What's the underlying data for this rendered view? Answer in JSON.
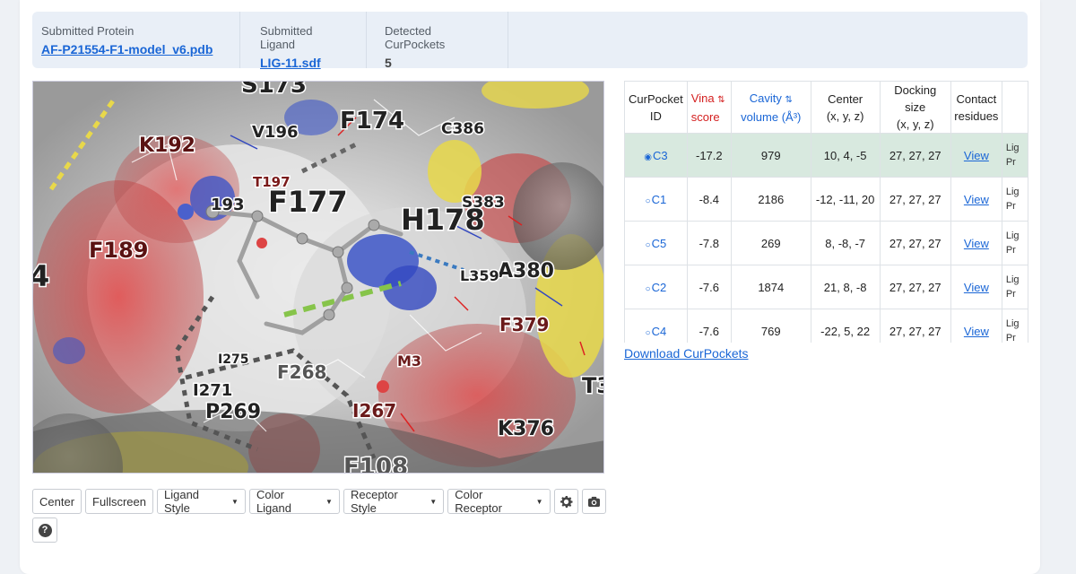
{
  "info": {
    "protein_label": "Submitted Protein",
    "protein_value": "AF-P21554-F1-model_v6.pdb",
    "ligand_label": "Submitted Ligand",
    "ligand_value": "LIG-11.sdf",
    "pockets_label": "Detected CurPockets",
    "pockets_value": "5"
  },
  "viewer": {
    "residue_labels": [
      "S173",
      "F174",
      "K192",
      "V196",
      "C386",
      "T197",
      "F177",
      "H178",
      "S383",
      "F189",
      "A380",
      "L359",
      "F379",
      "I275",
      "F268",
      "M3",
      "I271",
      "P269",
      "I267",
      "K376",
      "T3",
      "F108",
      "193",
      "4"
    ]
  },
  "toolbar": {
    "center": "Center",
    "fullscreen": "Fullscreen",
    "ligand_style": "Ligand Style",
    "color_ligand": "Color Ligand",
    "receptor_style": "Receptor Style",
    "color_receptor": "Color Receptor",
    "settings_icon": "gear-icon",
    "camera_icon": "camera-icon",
    "help_icon": "question-icon",
    "help_glyph": "?"
  },
  "table": {
    "headers": {
      "pocket_id_1": "CurPocket",
      "pocket_id_2": "ID",
      "vina_1": "Vina",
      "vina_2": "score",
      "cavity_1": "Cavity",
      "cavity_2": "volume (Å³)",
      "center_1": "Center",
      "center_2": "(x, y, z)",
      "docking_1": "Docking size",
      "docking_2": "(x, y, z)",
      "contact_1": "Contact",
      "contact_2": "residues",
      "sort_icon": "sort-icon"
    },
    "rows": [
      {
        "id": "C3",
        "vina": "-17.2",
        "cavity": "979",
        "center": "10, 4, -5",
        "docking": "27, 27, 27",
        "contact": "View",
        "extra1": "Lig",
        "extra2": "Pr",
        "selected": true
      },
      {
        "id": "C1",
        "vina": "-8.4",
        "cavity": "2186",
        "center": "-12, -11, 20",
        "docking": "27, 27, 27",
        "contact": "View",
        "extra1": "Lig",
        "extra2": "Pr"
      },
      {
        "id": "C5",
        "vina": "-7.8",
        "cavity": "269",
        "center": "8, -8, -7",
        "docking": "27, 27, 27",
        "contact": "View",
        "extra1": "Lig",
        "extra2": "Pr"
      },
      {
        "id": "C2",
        "vina": "-7.6",
        "cavity": "1874",
        "center": "21, 8, -8",
        "docking": "27, 27, 27",
        "contact": "View",
        "extra1": "Lig",
        "extra2": "Pr"
      },
      {
        "id": "C4",
        "vina": "-7.6",
        "cavity": "769",
        "center": "-22, 5, 22",
        "docking": "27, 27, 27",
        "contact": "View",
        "extra1": "Lig",
        "extra2": "Pr"
      }
    ],
    "download_label": "Download CurPockets"
  },
  "colors": {
    "link": "#1a66d6",
    "accent_red": "#d42020",
    "selected_row": "#d8e9df"
  }
}
